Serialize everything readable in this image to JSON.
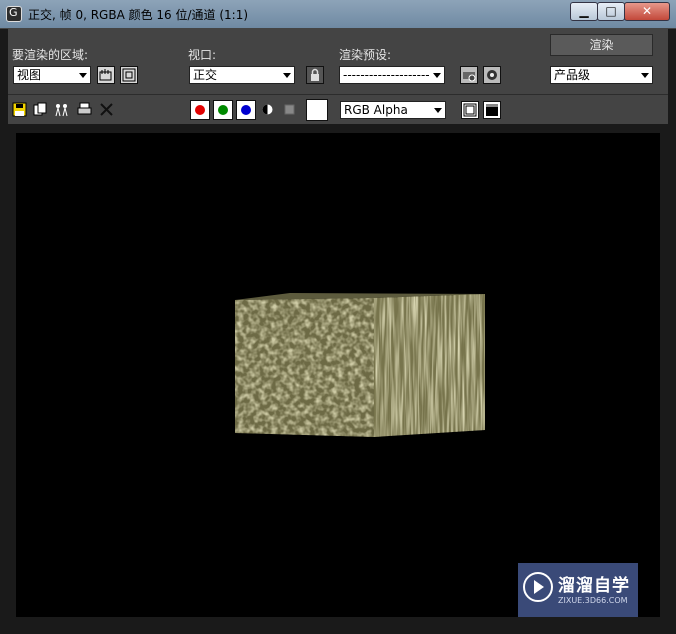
{
  "title": "正交, 帧 0, RGBA 颜色 16 位/通道 (1:1)",
  "window_controls": {
    "minimize": "▁",
    "maximize": "□",
    "close": "✕"
  },
  "labels": {
    "area": "要渲染的区域:",
    "viewport": "视口:",
    "preset": "渲染预设:"
  },
  "area_dropdown": {
    "value": "视图"
  },
  "viewport_dropdown": {
    "value": "正交"
  },
  "preset_dropdown": {
    "value": "--------------------"
  },
  "render_button": {
    "label": "渲染"
  },
  "quality_dropdown": {
    "value": "产品级"
  },
  "channel_dropdown": {
    "value": "RGB Alpha"
  },
  "channel_colors": {
    "red": "#e00000",
    "green": "#008a00",
    "blue": "#0000d0"
  },
  "watermark": {
    "title": "溜溜自学",
    "url": "ZIXUE.3D66.COM"
  },
  "icons": [
    "save-icon",
    "copy-icon",
    "clone-icon",
    "print-icon",
    "clear-icon",
    "lock-icon",
    "region-select-icon",
    "region-crop-icon",
    "environment-setup-icon",
    "teapot-icon",
    "red-channel-icon",
    "green-channel-icon",
    "blue-channel-icon",
    "monochrome-icon",
    "clear-color-icon",
    "display-toggle-icon",
    "window-toggle-icon"
  ]
}
